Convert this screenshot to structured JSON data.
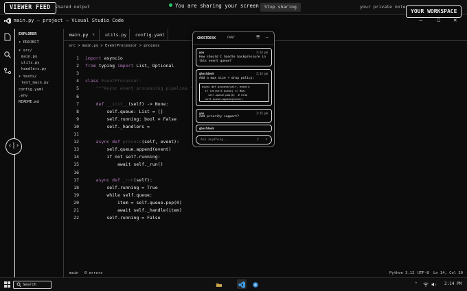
{
  "share_banner": {
    "viewer_feed": "VIEWER FEED",
    "shared_output": "shared output",
    "sharing_status": "You are sharing your screen",
    "stop_sharing": "Stop sharing",
    "private_notes": "your private notes",
    "your_workspace": "YOUR WORKSPACE",
    "status_color": "#27c46a"
  },
  "window": {
    "title": "main.py — project — Visual Studio Code",
    "controls": [
      "—",
      "☐",
      "✕"
    ]
  },
  "activity_bar": {
    "icons": [
      "files-icon",
      "search-icon",
      "source-control-icon",
      "debug-icon"
    ],
    "debug_glyph": "‹|›"
  },
  "explorer": {
    "header": "EXPLORER",
    "items": [
      {
        "label": "▾ PROJECT"
      },
      {
        "label": "▾ src/"
      },
      {
        "label": "main.py"
      },
      {
        "label": "utils.py"
      },
      {
        "label": "handlers.py"
      },
      {
        "label": "▾ tests/"
      },
      {
        "label": "test_main.py"
      },
      {
        "label": "config.yaml"
      },
      {
        "label": ".env"
      },
      {
        "label": "README.md"
      }
    ]
  },
  "editor": {
    "tabs": [
      {
        "label": "main.py",
        "close": "✕",
        "active": true
      },
      {
        "label": "utils.py",
        "active": false
      },
      {
        "label": "config.yaml",
        "active": false
      }
    ],
    "breadcrumb": "src > main.py > EventProcessor > process",
    "lines": [
      {
        "n": "1",
        "kw": "import",
        "rest": " asyncio"
      },
      {
        "n": "2",
        "kw": "from",
        "rest": " typing ",
        "kw2": "import",
        "rest2": " List, Optional"
      },
      {
        "n": "3"
      },
      {
        "n": "4",
        "kw": "class",
        "rest": " ",
        "ghost": "EventProcessor:"
      },
      {
        "n": "5",
        "indent": "    ",
        "ghost": "\"\"\"Async event processing pipeline.\"\"\""
      },
      {
        "n": "6"
      },
      {
        "n": "7",
        "indent": "    ",
        "kw": "def",
        "rest": " ",
        "ghost": "__init__",
        "rest2": "(self) -> None:"
      },
      {
        "n": "8",
        "indent": "        ",
        "rest": "self.queue: List = []"
      },
      {
        "n": "9",
        "indent": "        ",
        "rest": "self.running: bool = False"
      },
      {
        "n": "10",
        "indent": "        ",
        "rest": "self._handlers = "
      },
      {
        "n": "11"
      },
      {
        "n": "12",
        "indent": "    ",
        "kw": "async def",
        "rest": " ",
        "ghost": "process",
        "rest2": "(self, event):"
      },
      {
        "n": "13",
        "indent": "        ",
        "rest": "self.queue.append(event)"
      },
      {
        "n": "14",
        "indent": "        ",
        "rest": "if not self.running:"
      },
      {
        "n": "15",
        "indent": "            ",
        "rest": "await self._run()"
      },
      {
        "n": "16"
      },
      {
        "n": "17",
        "indent": "    ",
        "kw": "async def",
        "rest": " ",
        "ghost": "_run",
        "rest2": "(self):"
      },
      {
        "n": "18",
        "indent": "        ",
        "rest": "self.running = True"
      },
      {
        "n": "19",
        "indent": "        ",
        "rest": "while self.queue:"
      },
      {
        "n": "20",
        "indent": "            ",
        "rest": "item = self.queue.pop(0)"
      },
      {
        "n": "21",
        "indent": "            ",
        "rest": "await self._handle(item)"
      },
      {
        "n": "22",
        "indent": "        ",
        "rest": "self.running = False"
      }
    ],
    "keyword_color": "#b07ab8"
  },
  "status_bar": {
    "branch": "main",
    "errors": "0 errors",
    "language": "Python 3.12",
    "encoding": "UTF-8",
    "cursor": "Ln 14, Col 20"
  },
  "ghostdesk": {
    "title": "GHOSTDESK",
    "tab": "CHAT",
    "menu_icon": "☰",
    "minimize_icon": "−",
    "messages": [
      {
        "who": "you",
        "time": "2:14 pm",
        "text": "How should I handle backpressure in this event queue?"
      },
      {
        "who": "ghostdesk",
        "time": "2:14 pm",
        "text": "Add a max size + drop policy:",
        "code": [
          "async def process(self, event):",
          "  if len(self.queue) >= MAX:",
          "    self.queue.pop(0)  # drop",
          "  self.queue.append(event)"
        ]
      },
      {
        "who": "you",
        "time": "2:15 pm",
        "text": "Add priority support?"
      },
      {
        "who": "ghostdesk"
      }
    ],
    "input_placeholder": "Ask anything...",
    "attach_icon": "♪",
    "send_icon": "↑"
  },
  "taskbar": {
    "search_label": "Search",
    "time": "2:14 PM",
    "tray_icons": [
      "chevron-up-icon",
      "wifi-icon",
      "volume-icon"
    ]
  }
}
